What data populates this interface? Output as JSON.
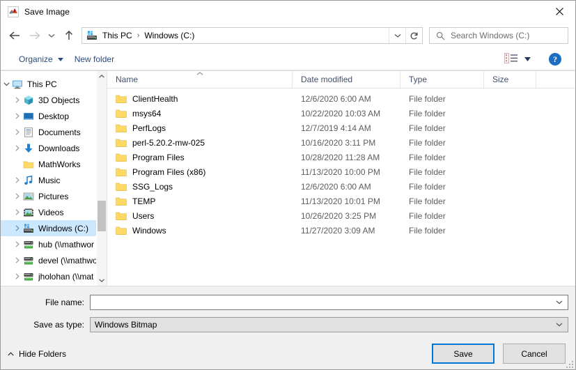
{
  "window": {
    "title": "Save Image",
    "app_icon": "matlab-icon",
    "close_label": "✕"
  },
  "nav": {
    "back_icon": "back-arrow-icon",
    "forward_icon": "forward-arrow-icon",
    "history_icon": "chevron-down-icon",
    "up_icon": "up-arrow-icon",
    "address": {
      "drive_icon": "drive-icon",
      "crumbs": [
        "This PC",
        "Windows (C:)"
      ],
      "separator": "›",
      "dropdown_icon": "chevron-down-icon",
      "refresh_icon": "refresh-icon"
    },
    "search": {
      "icon": "search-icon",
      "placeholder": "Search Windows (C:)",
      "value": ""
    }
  },
  "command_bar": {
    "organize_label": "Organize",
    "organize_caret": "caret-down-icon",
    "new_folder_label": "New folder",
    "view_icon": "view-layout-icon",
    "view_caret": "caret-down-icon",
    "help_label": "?",
    "help_icon": "help-icon"
  },
  "tree": {
    "items": [
      {
        "label": "This PC",
        "icon": "computer-icon",
        "indent": 0,
        "expander": "chevron-down",
        "selected": false
      },
      {
        "label": "3D Objects",
        "icon": "3d-objects-icon",
        "indent": 1,
        "expander": "chevron-right",
        "selected": false
      },
      {
        "label": "Desktop",
        "icon": "desktop-icon",
        "indent": 1,
        "expander": "chevron-right",
        "selected": false
      },
      {
        "label": "Documents",
        "icon": "documents-icon",
        "indent": 1,
        "expander": "chevron-right",
        "selected": false
      },
      {
        "label": "Downloads",
        "icon": "downloads-icon",
        "indent": 1,
        "expander": "chevron-right",
        "selected": false
      },
      {
        "label": "MathWorks",
        "icon": "folder-icon",
        "indent": 1,
        "expander": "none",
        "selected": false
      },
      {
        "label": "Music",
        "icon": "music-icon",
        "indent": 1,
        "expander": "chevron-right",
        "selected": false
      },
      {
        "label": "Pictures",
        "icon": "pictures-icon",
        "indent": 1,
        "expander": "chevron-right",
        "selected": false
      },
      {
        "label": "Videos",
        "icon": "videos-icon",
        "indent": 1,
        "expander": "chevron-right",
        "selected": false
      },
      {
        "label": "Windows (C:)",
        "icon": "drive-icon",
        "indent": 1,
        "expander": "chevron-right",
        "selected": true
      },
      {
        "label": "hub (\\\\mathwor",
        "icon": "network-drive-icon",
        "indent": 1,
        "expander": "chevron-right",
        "selected": false
      },
      {
        "label": "devel (\\\\mathwo",
        "icon": "network-drive-icon",
        "indent": 1,
        "expander": "chevron-right",
        "selected": false
      },
      {
        "label": "jholohan (\\\\mat",
        "icon": "network-drive-icon",
        "indent": 1,
        "expander": "chevron-right",
        "selected": false
      }
    ],
    "scrollbar": {
      "up_icon": "scroll-up-icon",
      "down_icon": "scroll-down-icon"
    }
  },
  "file_list": {
    "columns": [
      "Name",
      "Date modified",
      "Type",
      "Size"
    ],
    "sort_column": "Name",
    "sort_direction": "ascending",
    "sort_icon": "caret-up-icon",
    "rows": [
      {
        "name": "ClientHealth",
        "date": "12/6/2020 6:00 AM",
        "type": "File folder",
        "size": "",
        "icon": "folder-icon"
      },
      {
        "name": "msys64",
        "date": "10/22/2020 10:03 AM",
        "type": "File folder",
        "size": "",
        "icon": "folder-icon"
      },
      {
        "name": "PerfLogs",
        "date": "12/7/2019 4:14 AM",
        "type": "File folder",
        "size": "",
        "icon": "folder-icon"
      },
      {
        "name": "perl-5.20.2-mw-025",
        "date": "10/16/2020 3:11 PM",
        "type": "File folder",
        "size": "",
        "icon": "folder-icon"
      },
      {
        "name": "Program Files",
        "date": "10/28/2020 11:28 AM",
        "type": "File folder",
        "size": "",
        "icon": "folder-icon"
      },
      {
        "name": "Program Files (x86)",
        "date": "11/13/2020 10:00 PM",
        "type": "File folder",
        "size": "",
        "icon": "folder-icon"
      },
      {
        "name": "SSG_Logs",
        "date": "12/6/2020 6:00 AM",
        "type": "File folder",
        "size": "",
        "icon": "folder-icon"
      },
      {
        "name": "TEMP",
        "date": "11/13/2020 10:01 PM",
        "type": "File folder",
        "size": "",
        "icon": "folder-icon"
      },
      {
        "name": "Users",
        "date": "10/26/2020 3:25 PM",
        "type": "File folder",
        "size": "",
        "icon": "folder-icon"
      },
      {
        "name": "Windows",
        "date": "11/27/2020 3:09 AM",
        "type": "File folder",
        "size": "",
        "icon": "folder-icon"
      }
    ]
  },
  "form": {
    "file_name_label": "File name:",
    "file_name_value": "",
    "file_name_placeholder": "",
    "save_as_type_label": "Save as type:",
    "save_as_type_value": "Windows Bitmap",
    "dropdown_icon": "chevron-down-icon"
  },
  "footer": {
    "hide_folders_label": "Hide Folders",
    "hide_folders_icon": "caret-up-icon",
    "save_label": "Save",
    "cancel_label": "Cancel"
  },
  "colors": {
    "accent": "#0078d7",
    "selection": "#cce8ff",
    "chrome": "#f0f0f0",
    "link": "#2b4c7e",
    "folder": "#ffd966",
    "help_blue": "#1b6ec2"
  }
}
